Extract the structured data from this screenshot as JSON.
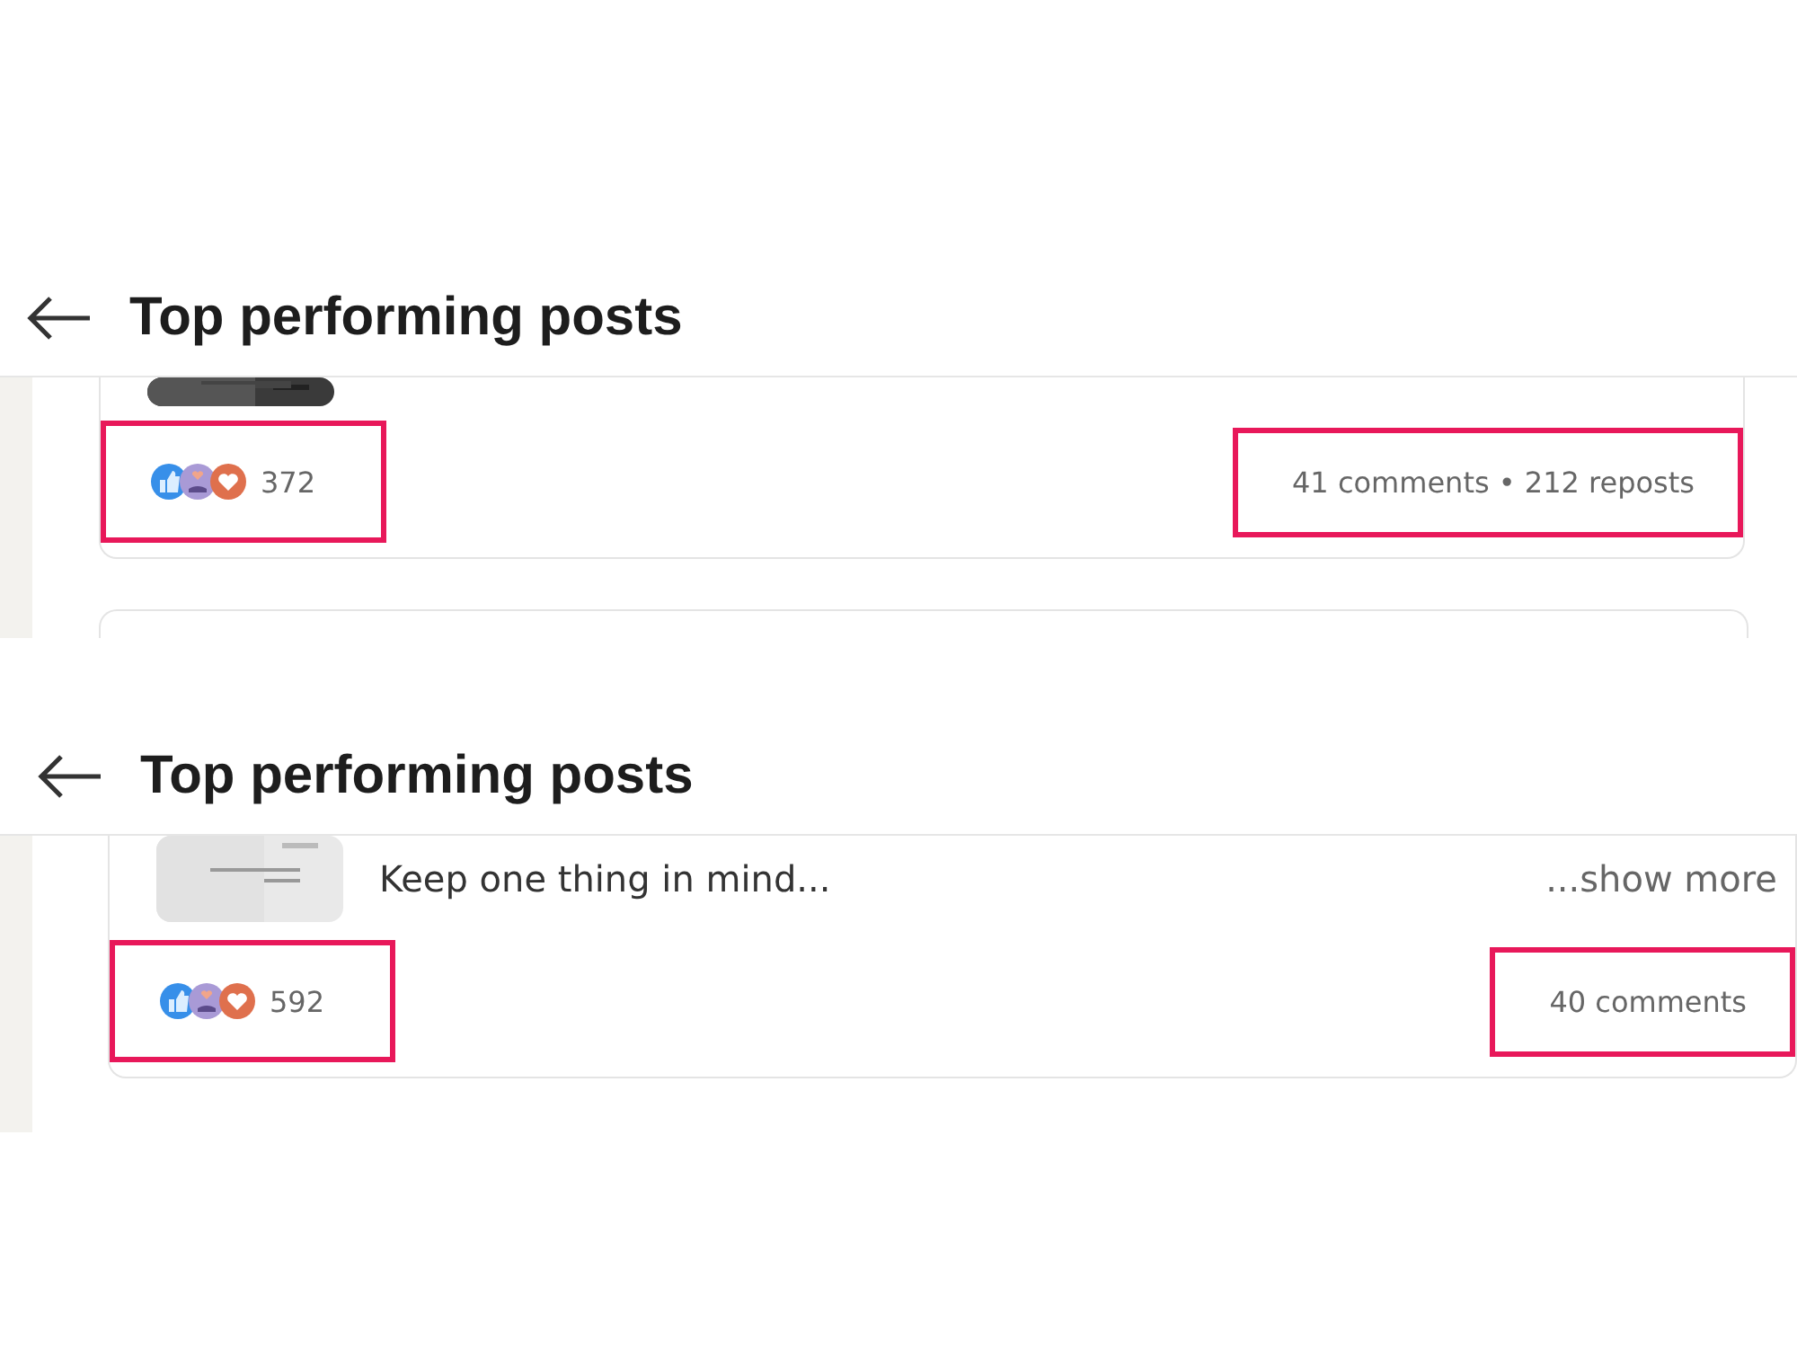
{
  "panels": [
    {
      "title": "Top performing posts",
      "post": {
        "reactions": {
          "count": "372",
          "highlighted": true
        },
        "stats": {
          "text": "41 comments • 212 reposts",
          "highlighted": true
        }
      },
      "next_card": true
    },
    {
      "title": "Top performing posts",
      "post": {
        "excerpt": "Keep one thing in mind...",
        "show_more": "...show more",
        "reactions": {
          "count": "592",
          "highlighted": true
        },
        "stats": {
          "text": "40 comments",
          "highlighted": true
        }
      },
      "next_card": false
    }
  ]
}
